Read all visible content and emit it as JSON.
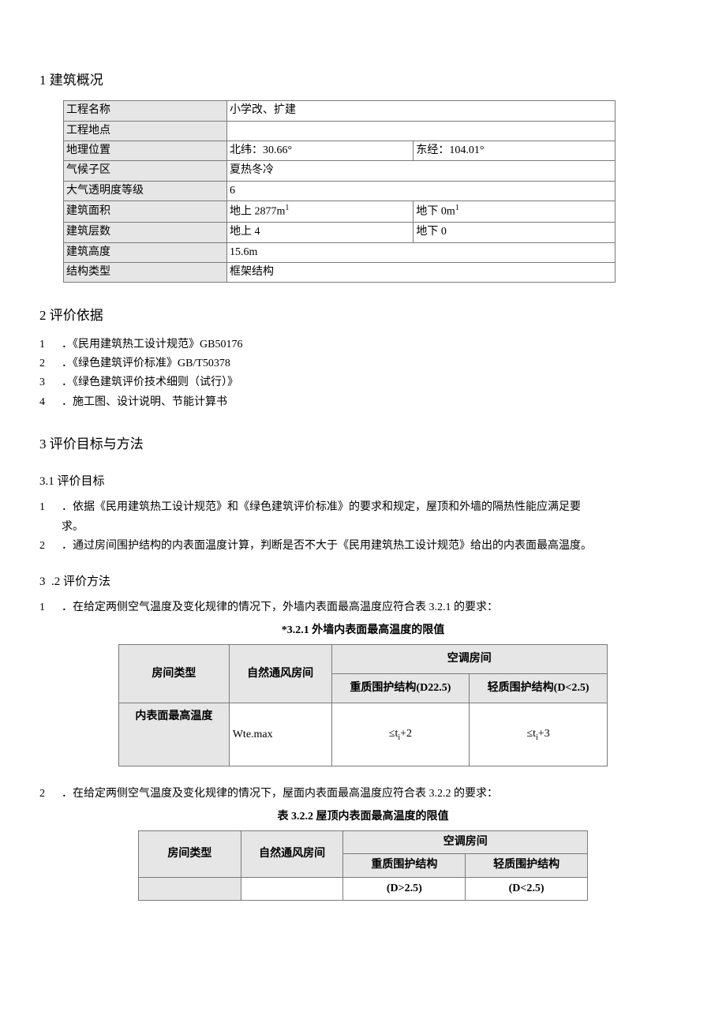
{
  "sec1": {
    "title": "1 建筑概况",
    "rows": {
      "r1l": "工程名称",
      "r1v": "小学改、扩建",
      "r2l": "工程地点",
      "r2v": "",
      "r3l": "地理位置",
      "r3v1": "北纬：30.66°",
      "r3v2": "东经：104.01°",
      "r4l": "气候子区",
      "r4v": "夏热冬冷",
      "r5l": "大气透明度等级",
      "r5v": "6",
      "r6l": "建筑面积",
      "r6v1a": "地上 2877m",
      "r6v1b": "1",
      "r6v2a": "地下 0m",
      "r6v2b": "1",
      "r7l": "建筑层数",
      "r7v1": "地上 4",
      "r7v2": "地下 0",
      "r8l": "建筑高度",
      "r8v": "15.6m",
      "r9l": "结构类型",
      "r9v": "框架结构"
    }
  },
  "sec2": {
    "title": "2 评价依据",
    "items": [
      "．《民用建筑热工设计规范》GB50176",
      "．《绿色建筑评价标准》GB/T50378",
      "．《绿色建筑评价技术细则（试行）》",
      "．施工图、设计说明、节能计算书"
    ],
    "nums": [
      "1",
      "2",
      "3",
      "4"
    ]
  },
  "sec3": {
    "title": "3 评价目标与方法",
    "s31": {
      "title": "3.1 评价目标",
      "n1": "1",
      "t1a": "．依据《民用建筑热工设计规范》和《绿色建筑评价标准》的要求和规定，屋顶和外墙的隔热性能应满足要",
      "t1b": "求。",
      "n2": "2",
      "t2": "．通过房间围护结构的内表面温度计算，判断是否不大于《民用建筑热工设计规范》给出的内表面最高温度。"
    },
    "s32": {
      "title_num": "3",
      "title_txt": ".2 评价方法",
      "n1": "1",
      "t1": "．在给定两侧空气温度及变化规律的情况下，外墙内表面最高温度应符合表 3.2.1 的要求：",
      "cap1": "*3.2.1 外墙内表面最高温度的限值",
      "tbl1": {
        "h_room": "房间类型",
        "h_nat": "自然通风房间",
        "h_ac": "空调房间",
        "h_heavy": "重质围护结构(D22.5)",
        "h_light": "轻质围护结构(D<2.5)",
        "rowlbl": "内表面最高温度",
        "v_nat": "Wte.max",
        "v_heavy_a": "≤t",
        "v_heavy_b": "i",
        "v_heavy_c": "+2",
        "v_light_a": "≤t",
        "v_light_b": "i",
        "v_light_c": "+3"
      },
      "n2": "2",
      "t2": "．在给定两侧空气温度及变化规律的情况下，屋面内表面最高温度应符合表 3.2.2 的要求：",
      "cap2": "表 3.2.2 屋顶内表面最高温度的限值",
      "tbl2": {
        "h_room": "房间类型",
        "h_nat": "自然通风房间",
        "h_ac": "空调房间",
        "h_heavy": "重质围护结构",
        "h_light": "轻质围护结构",
        "d_heavy": "(D>2.5)",
        "d_light": "(D<2.5)"
      }
    }
  }
}
